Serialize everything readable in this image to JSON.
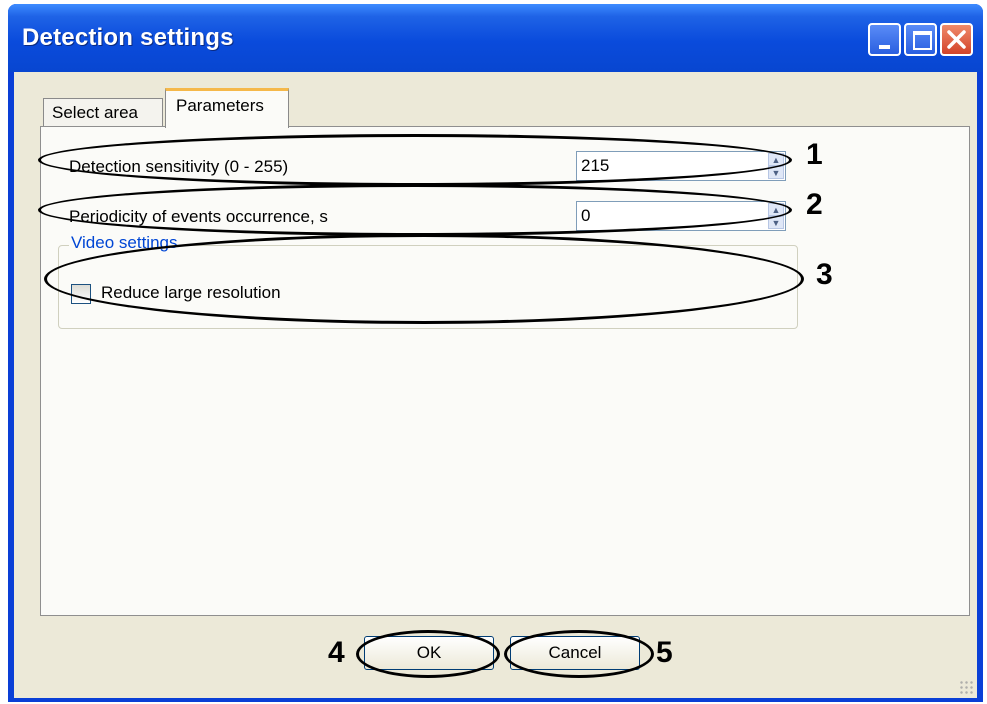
{
  "window": {
    "title": "Detection settings"
  },
  "titlebar_buttons": [
    "minimize-icon",
    "maximize-icon",
    "close-icon"
  ],
  "tabs": [
    {
      "label": "Select area",
      "active": false
    },
    {
      "label": "Parameters",
      "active": true
    }
  ],
  "parameters": {
    "sensitivity": {
      "label": "Detection sensitivity (0 - 255)",
      "value": "215"
    },
    "periodicity": {
      "label": "Periodicity of events occurrence, s",
      "value": "0"
    },
    "video_group": {
      "legend": "Video settings",
      "checkbox_label": "Reduce large resolution",
      "checked": false
    }
  },
  "buttons": {
    "ok": "OK",
    "cancel": "Cancel"
  },
  "callouts": [
    "1",
    "2",
    "3",
    "4",
    "5"
  ],
  "colors": {
    "titlebar": "#0a4bdc",
    "client": "#ece9d8",
    "group_legend": "#0046d5",
    "close_button": "#d2432a",
    "active_tab_accent": "#f5b84a"
  }
}
